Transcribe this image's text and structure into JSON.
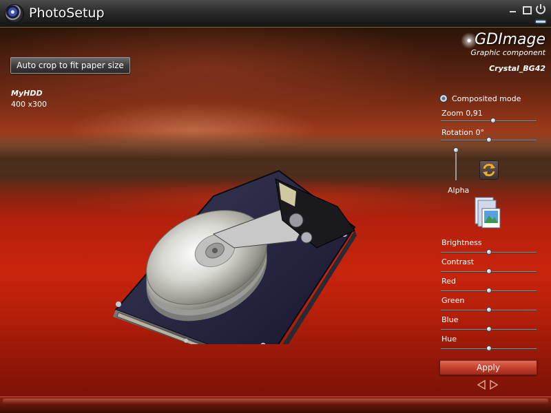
{
  "window": {
    "title": "PhotoSetup",
    "buttons": [
      "minimize",
      "maximize",
      "close"
    ]
  },
  "toolbar": {
    "auto_crop_label": "Auto crop to fit paper size"
  },
  "image_info": {
    "name": "MyHDD",
    "size": "400 x300"
  },
  "brand": {
    "title": "GDImage",
    "subtitle": "Graphic component",
    "theme": "Crystal_BG42"
  },
  "panel": {
    "composited_label": "Composited mode",
    "composited_checked": true,
    "zoom_label": "Zoom 0,91",
    "zoom_value": 0.55,
    "rotation_label": "Rotation 0°",
    "rotation_value": 0.5,
    "alpha_label": "Alpha",
    "alpha_value": 1.0,
    "sliders": [
      {
        "label": "Brightness",
        "value": 0.5
      },
      {
        "label": "Contrast",
        "value": 0.5
      },
      {
        "label": "Red",
        "value": 0.5
      },
      {
        "label": "Green",
        "value": 0.5
      },
      {
        "label": "Blue",
        "value": 0.5
      },
      {
        "label": "Hue",
        "value": 0.5
      }
    ],
    "apply_label": "Apply"
  },
  "icons": {
    "app_logo": "camera-lens-icon",
    "swap": "swap-arrows-icon",
    "photo": "photo-stack-icon",
    "prev": "triangle-left-icon",
    "next": "triangle-right-icon"
  },
  "colors": {
    "accent_apply": "#c23e2a",
    "workspace_red": "#c8240c"
  }
}
